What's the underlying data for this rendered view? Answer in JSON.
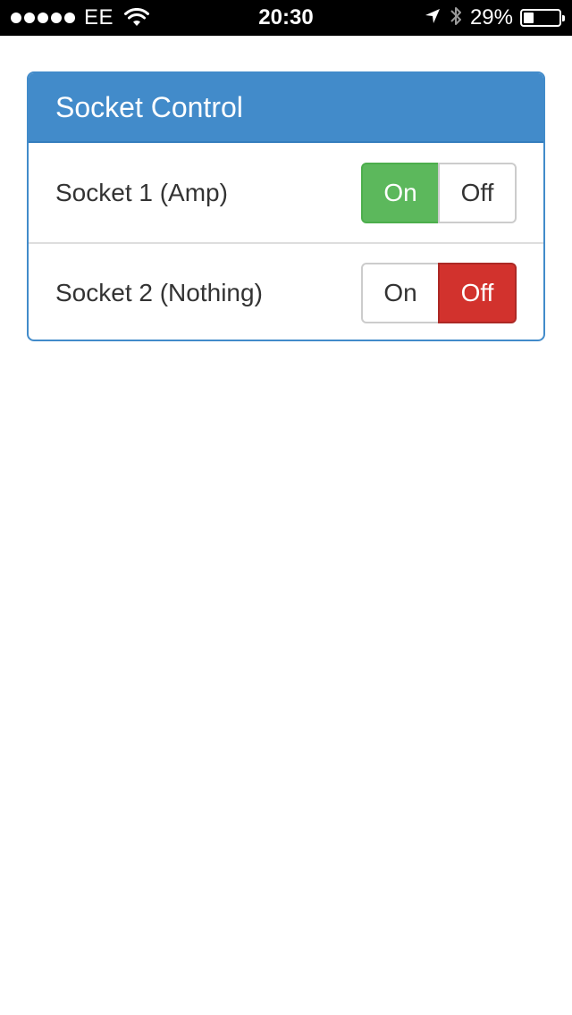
{
  "status_bar": {
    "carrier": "EE",
    "time": "20:30",
    "battery_percent_text": "29%",
    "battery_level": 0.29,
    "signal_bars": 5,
    "icons": [
      "signal-dots-icon",
      "wifi-icon",
      "location-arrow-icon",
      "bluetooth-icon",
      "battery-icon"
    ]
  },
  "panel": {
    "title": "Socket Control",
    "accent_color": "#428bca",
    "sockets": [
      {
        "label": "Socket 1 (Amp)",
        "on_label": "On",
        "off_label": "Off",
        "state": "on",
        "on_color": "#5cb85c"
      },
      {
        "label": "Socket 2 (Nothing)",
        "on_label": "On",
        "off_label": "Off",
        "state": "off",
        "off_color": "#d2322d"
      }
    ]
  }
}
